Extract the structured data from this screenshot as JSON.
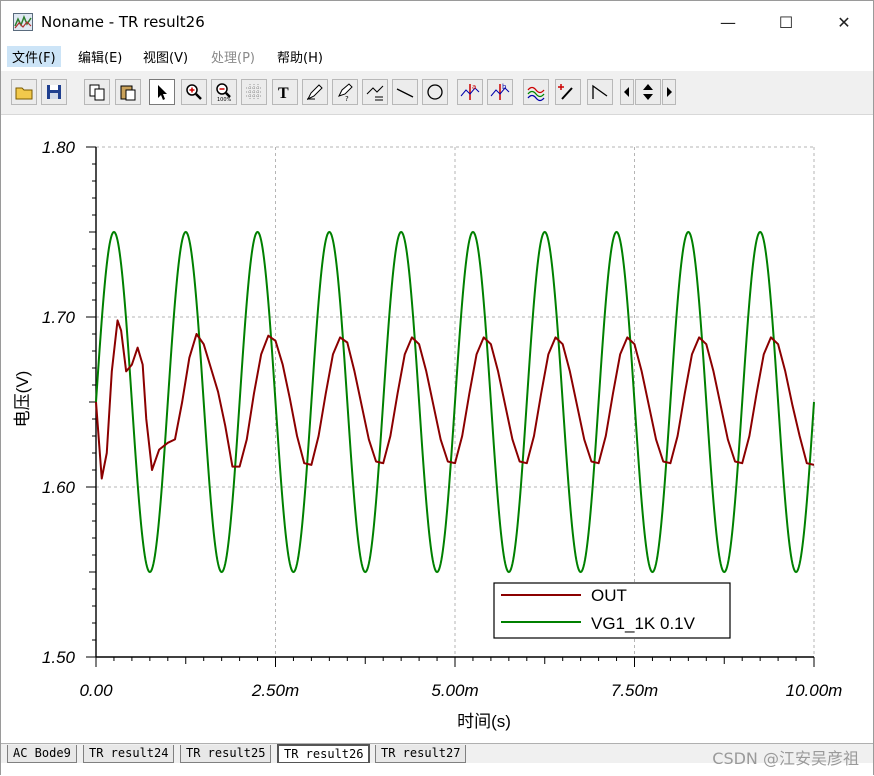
{
  "window": {
    "title": "Noname - TR result26",
    "controls": {
      "minimize": "—",
      "maximize": "☐",
      "close": "✕"
    }
  },
  "menu": [
    {
      "label": "文件(F)",
      "active": true,
      "disabled": false
    },
    {
      "label": "编辑(E)",
      "active": false,
      "disabled": false
    },
    {
      "label": "视图(V)",
      "active": false,
      "disabled": false
    },
    {
      "label": "处理(P)",
      "active": false,
      "disabled": true
    },
    {
      "label": "帮助(H)",
      "active": false,
      "disabled": false
    }
  ],
  "toolbar": [
    "open-folder-icon",
    "save-icon",
    "copy-icon",
    "paste-icon",
    "pointer-icon",
    "zoom-in-icon",
    "zoom-100-icon",
    "grid-icon",
    "text-icon",
    "pen-icon",
    "pen-label-icon",
    "pen-list-icon",
    "line-icon",
    "circle-icon",
    "cursor-a-icon",
    "cursor-b-icon",
    "curves-icon",
    "marker-icon",
    "ramp-icon",
    "scroll-left-icon",
    "scroll-updown-icon",
    "scroll-right-icon"
  ],
  "chart_data": {
    "type": "line",
    "xlabel": "时间(s)",
    "ylabel": "电压(V)",
    "xlim": [
      0,
      0.01
    ],
    "ylim": [
      1.5,
      1.8
    ],
    "x_ticks": [
      "0.00",
      "2.50m",
      "5.00m",
      "7.50m",
      "10.00m"
    ],
    "y_ticks": [
      "1.50",
      "1.60",
      "1.70",
      "1.80"
    ],
    "grid": true,
    "legend_position": "bottom-right",
    "series": [
      {
        "name": "OUT",
        "color": "#8b0000",
        "x": [
          0,
          8e-05,
          0.00015,
          0.00022,
          0.0003,
          0.00035,
          0.00042,
          0.0005,
          0.00058,
          0.00065,
          0.0007,
          0.00078,
          0.00088,
          0.001,
          0.0011,
          0.0012,
          0.0013,
          0.0014,
          0.0015,
          0.0016,
          0.0017,
          0.0018,
          0.0019,
          0.002,
          0.0021,
          0.0022,
          0.0023,
          0.0024,
          0.0025,
          0.0026,
          0.0027,
          0.0028,
          0.0029,
          0.003,
          0.0031,
          0.0032,
          0.0033,
          0.0034,
          0.0035,
          0.0036,
          0.0037,
          0.0038,
          0.0039,
          0.004,
          0.0041,
          0.0042,
          0.0043,
          0.0044,
          0.0045,
          0.0046,
          0.0047,
          0.0048,
          0.0049,
          0.005,
          0.0051,
          0.0052,
          0.0053,
          0.0054,
          0.0055,
          0.0056,
          0.0057,
          0.0058,
          0.0059,
          0.006,
          0.0061,
          0.0062,
          0.0063,
          0.0064,
          0.0065,
          0.0066,
          0.0067,
          0.0068,
          0.0069,
          0.007,
          0.0071,
          0.0072,
          0.0073,
          0.0074,
          0.0075,
          0.0076,
          0.0077,
          0.0078,
          0.0079,
          0.008,
          0.0081,
          0.0082,
          0.0083,
          0.0084,
          0.0085,
          0.0086,
          0.0087,
          0.0088,
          0.0089,
          0.009,
          0.0091,
          0.0092,
          0.0093,
          0.0094,
          0.0095,
          0.0096,
          0.0097,
          0.0098,
          0.0099,
          0.01
        ],
        "values": [
          1.65,
          1.605,
          1.62,
          1.668,
          1.698,
          1.692,
          1.668,
          1.672,
          1.682,
          1.672,
          1.64,
          1.61,
          1.622,
          1.626,
          1.628,
          1.65,
          1.676,
          1.69,
          1.684,
          1.67,
          1.656,
          1.636,
          1.612,
          1.612,
          1.628,
          1.655,
          1.678,
          1.689,
          1.686,
          1.672,
          1.652,
          1.63,
          1.614,
          1.613,
          1.63,
          1.655,
          1.678,
          1.688,
          1.685,
          1.668,
          1.648,
          1.628,
          1.615,
          1.614,
          1.63,
          1.655,
          1.678,
          1.688,
          1.684,
          1.668,
          1.648,
          1.628,
          1.615,
          1.614,
          1.63,
          1.655,
          1.678,
          1.688,
          1.684,
          1.668,
          1.648,
          1.628,
          1.615,
          1.614,
          1.63,
          1.655,
          1.678,
          1.688,
          1.684,
          1.668,
          1.648,
          1.628,
          1.615,
          1.614,
          1.63,
          1.655,
          1.678,
          1.688,
          1.684,
          1.668,
          1.648,
          1.628,
          1.615,
          1.614,
          1.63,
          1.655,
          1.678,
          1.688,
          1.684,
          1.668,
          1.648,
          1.628,
          1.615,
          1.614,
          1.63,
          1.655,
          1.678,
          1.688,
          1.684,
          1.668,
          1.648,
          1.63,
          1.614,
          1.613
        ]
      },
      {
        "name": "VG1_1K 0.1V",
        "color": "#008000",
        "function": "sine",
        "offset": 1.65,
        "amplitude": 0.1,
        "frequency": 1000,
        "x_range": [
          0,
          0.01
        ]
      }
    ]
  },
  "tabs": [
    {
      "label": "AC Bode9",
      "active": false
    },
    {
      "label": "TR result24",
      "active": false
    },
    {
      "label": "TR result25",
      "active": false
    },
    {
      "label": "TR result26",
      "active": true
    },
    {
      "label": "TR result27",
      "active": false
    }
  ],
  "watermark": "CSDN @江安吴彦祖"
}
